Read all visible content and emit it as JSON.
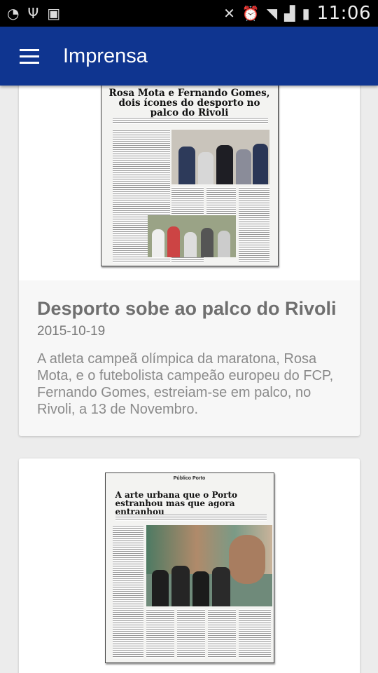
{
  "status_bar": {
    "time": "11:06"
  },
  "app_bar": {
    "title": "Imprensa",
    "menu_icon": "hamburger-menu-icon"
  },
  "articles": [
    {
      "image_headline": "Rosa Mota e Fernando Gomes, dois ícones do desporto no palco do Rivoli",
      "title": "Desporto sobe ao palco do Rivoli",
      "date": "2015-10-19",
      "summary": "A atleta campeã olímpica da maratona, Rosa Mota, e o futebolista campeão europeu do FCP, Fernando Gomes, estreiam-se em palco, no Rivoli, a 13 de Novembro."
    },
    {
      "image_masthead": "Público Porto",
      "image_headline": "A arte urbana que o Porto estranhou mas que agora entranhou"
    }
  ]
}
